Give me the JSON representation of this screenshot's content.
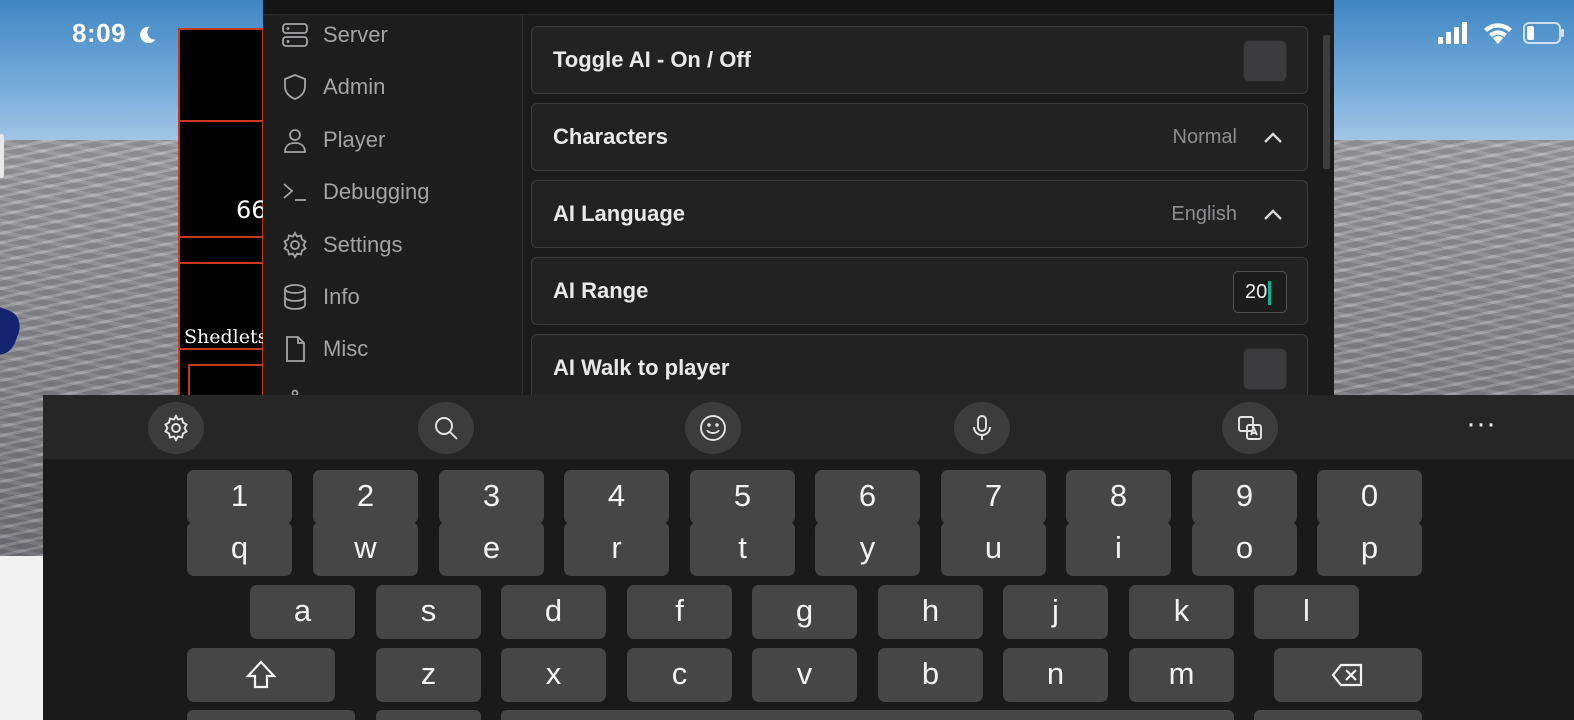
{
  "status_bar": {
    "time": "8:09"
  },
  "game": {
    "board_number": "66",
    "board_name": "Shedletsk"
  },
  "menu": {
    "nav": [
      {
        "label": "Server",
        "icon": "server-icon"
      },
      {
        "label": "Admin",
        "icon": "shield-icon"
      },
      {
        "label": "Player",
        "icon": "user-icon"
      },
      {
        "label": "Debugging",
        "icon": "terminal-icon"
      },
      {
        "label": "Settings",
        "icon": "gear-icon"
      },
      {
        "label": "Info",
        "icon": "database-icon"
      },
      {
        "label": "Misc",
        "icon": "file-icon"
      }
    ],
    "settings": {
      "toggle_ai": {
        "label": "Toggle AI - On / Off",
        "checked": false
      },
      "characters": {
        "label": "Characters",
        "value": "Normal"
      },
      "ai_language": {
        "label": "AI Language",
        "value": "English"
      },
      "ai_range": {
        "label": "AI Range",
        "value": "20"
      },
      "ai_walk": {
        "label": "AI Walk to player",
        "checked": false
      }
    }
  },
  "keyboard": {
    "toolbar": [
      "gear-icon",
      "search-icon",
      "emoji-icon",
      "microphone-icon",
      "translate-icon",
      "more-icon"
    ],
    "more_label": "···",
    "row_numbers": [
      "1",
      "2",
      "3",
      "4",
      "5",
      "6",
      "7",
      "8",
      "9",
      "0"
    ],
    "row_top": [
      "q",
      "w",
      "e",
      "r",
      "t",
      "y",
      "u",
      "i",
      "o",
      "p"
    ],
    "row_home": [
      "a",
      "s",
      "d",
      "f",
      "g",
      "h",
      "j",
      "k",
      "l"
    ],
    "row_bottom": [
      "z",
      "x",
      "c",
      "v",
      "b",
      "n",
      "m"
    ]
  },
  "colors": {
    "accent_caret": "#0bb394",
    "board_border": "#c43a1a",
    "menu_bg": "#1b1b1c"
  }
}
